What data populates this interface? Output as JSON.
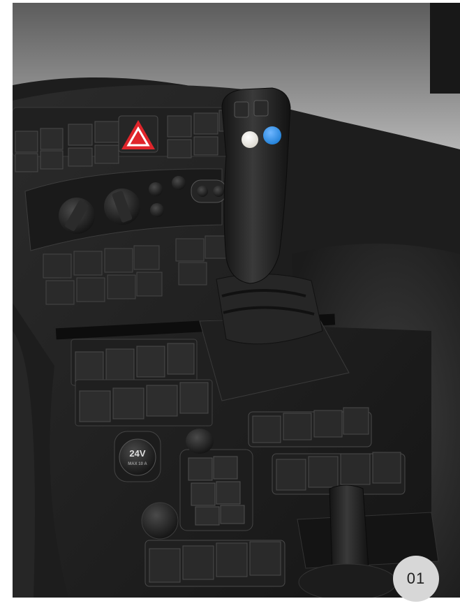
{
  "figure": {
    "badge_label": "01",
    "socket_label": "24V",
    "socket_sublabel": "MAX 10 A",
    "hazard_color": "#e0252b",
    "joystick_button_colors": [
      "#f1efe8",
      "#1f7fd6"
    ],
    "icons": [
      "hazard-warning-icon",
      "power-socket-icon",
      "joystick-icon",
      "gear-lever-icon"
    ]
  }
}
